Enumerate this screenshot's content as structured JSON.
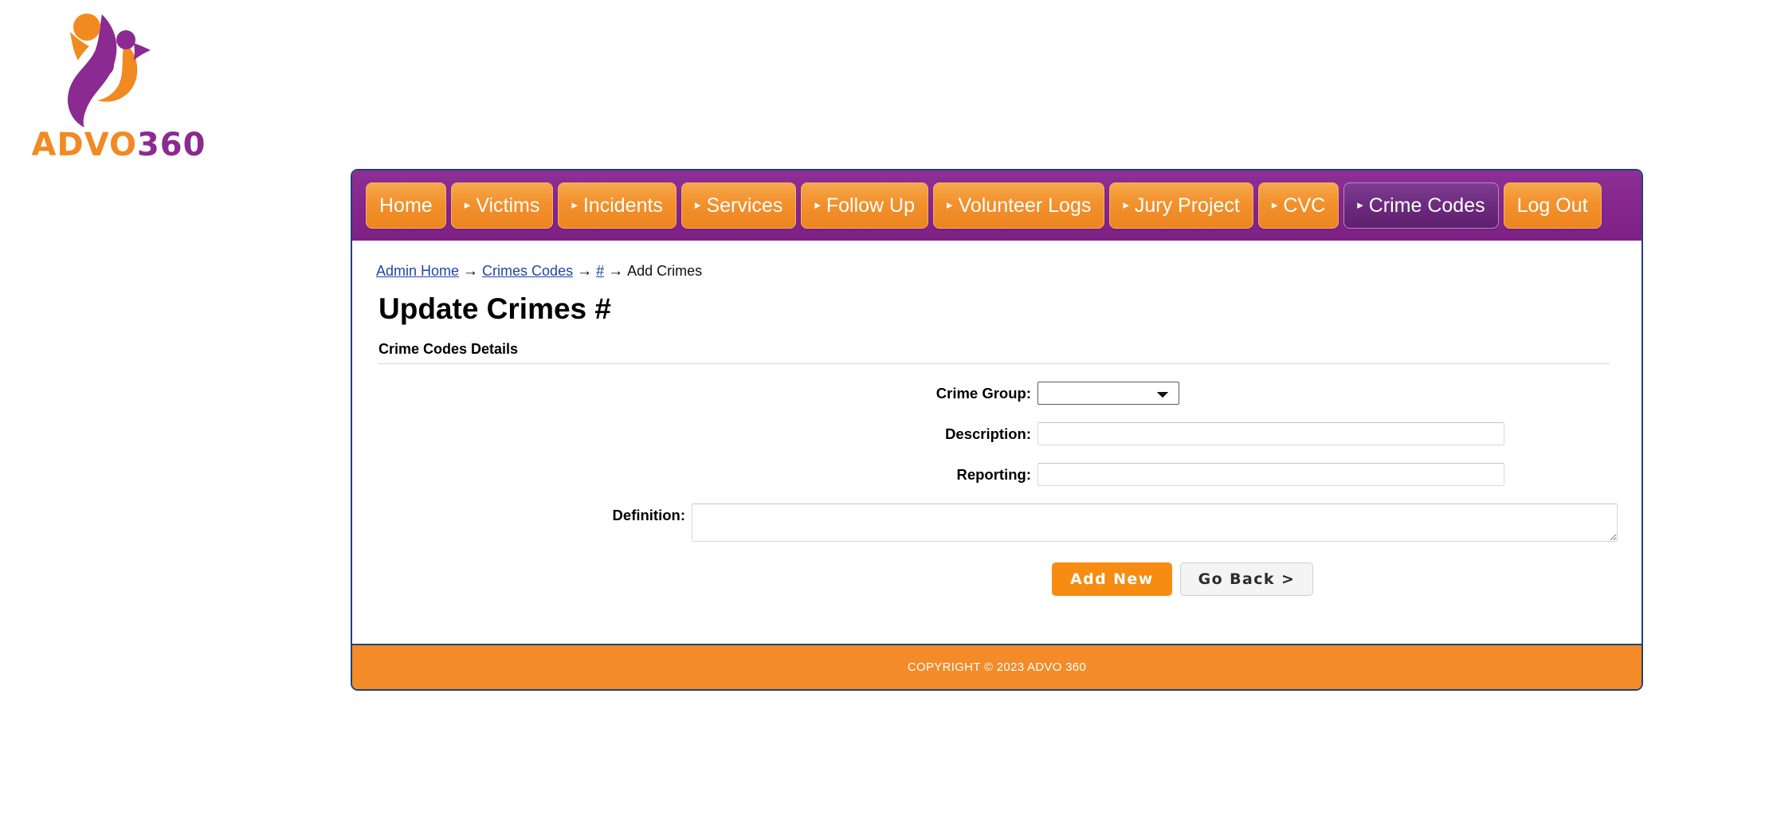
{
  "logo": {
    "brand_primary": "ADVO",
    "brand_secondary": "360",
    "orange": "#f18a21",
    "purple": "#8b2a91"
  },
  "nav": {
    "items": [
      {
        "label": "Home",
        "caret": false,
        "active": false
      },
      {
        "label": "Victims",
        "caret": true,
        "active": false
      },
      {
        "label": "Incidents",
        "caret": true,
        "active": false
      },
      {
        "label": "Services",
        "caret": true,
        "active": false
      },
      {
        "label": "Follow Up",
        "caret": true,
        "active": false
      },
      {
        "label": "Volunteer Logs",
        "caret": true,
        "active": false
      },
      {
        "label": "Jury Project",
        "caret": true,
        "active": false
      },
      {
        "label": "CVC",
        "caret": true,
        "active": false
      },
      {
        "label": "Crime Codes",
        "caret": true,
        "active": true
      },
      {
        "label": "Log Out",
        "caret": false,
        "active": false
      }
    ],
    "caret_glyph": "▸"
  },
  "breadcrumb": {
    "arrow": "→",
    "items": [
      {
        "label": "Admin Home",
        "link": true
      },
      {
        "label": "Crimes Codes",
        "link": true
      },
      {
        "label": "#",
        "link": true
      },
      {
        "label": "Add Crimes",
        "link": false
      }
    ]
  },
  "page": {
    "title": "Update Crimes #",
    "legend": "Crime Codes Details"
  },
  "form": {
    "crime_group": {
      "label": "Crime Group:",
      "value": "",
      "selected_option": "",
      "options": [
        ""
      ]
    },
    "description": {
      "label": "Description:",
      "value": "",
      "placeholder": ""
    },
    "reporting": {
      "label": "Reporting:",
      "value": "",
      "placeholder": ""
    },
    "definition": {
      "label": "Definition:",
      "value": "",
      "placeholder": ""
    }
  },
  "actions": {
    "submit_label": "Add New",
    "back_label": "Go Back >"
  },
  "footer": {
    "copyright": "COPYRIGHT © 2023 ADVO 360"
  }
}
